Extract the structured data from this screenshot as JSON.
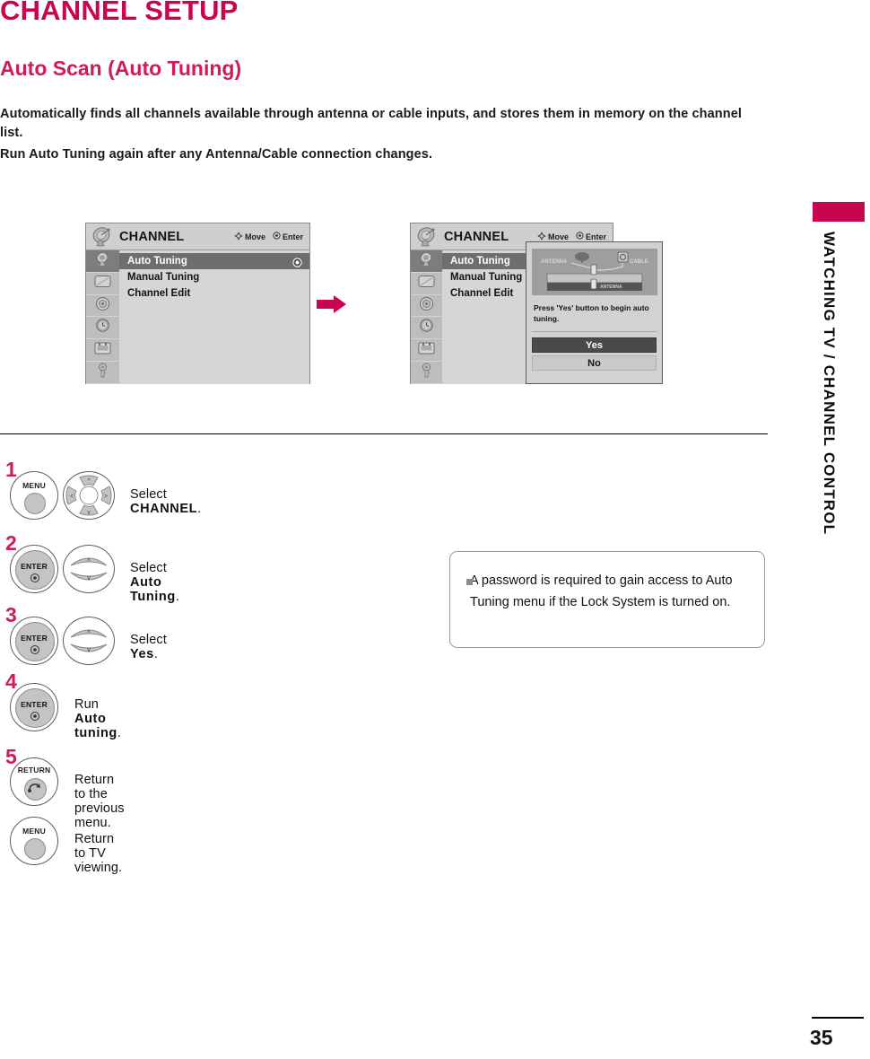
{
  "document": {
    "chapter_title": "CHANNEL SETUP",
    "section_title": "Auto Scan (Auto Tuning)",
    "paragraphs": [
      "Automatically finds all channels available through antenna or cable inputs, and stores them in memory on the channel list.",
      "Run Auto Tuning again after any Antenna/Cable connection changes."
    ],
    "side_tab_label": "WATCHING TV / CHANNEL CONTROL",
    "page_number": "35",
    "accent_color": "#c8064f"
  },
  "osd_before": {
    "menu_title": "CHANNEL",
    "header_icon": "satellite-dish-icon",
    "hints": [
      {
        "icon": "dpad-icon",
        "label": "Move"
      },
      {
        "icon": "enter-dot-icon",
        "label": "Enter"
      }
    ],
    "rail_icons": [
      "channel-dish-icon",
      "picture-tv-icon",
      "audio-speaker-icon",
      "time-clock-icon",
      "option-card-icon",
      "lock-key-icon"
    ],
    "items": [
      {
        "label": "Auto Tuning",
        "selected": true,
        "marker": "radio-dot-icon"
      },
      {
        "label": "Manual Tuning",
        "selected": false
      },
      {
        "label": "Channel Edit",
        "selected": false
      }
    ]
  },
  "osd_after": {
    "menu_title": "CHANNEL",
    "header_icon": "satellite-dish-icon",
    "hints": [
      {
        "icon": "dpad-icon",
        "label": "Move"
      },
      {
        "icon": "enter-dot-icon",
        "label": "Enter"
      }
    ],
    "rail_icons": [
      "channel-dish-icon",
      "picture-tv-icon",
      "audio-speaker-icon",
      "time-clock-icon",
      "option-card-icon",
      "lock-key-icon"
    ],
    "items": [
      {
        "label": "Auto Tuning",
        "selected": true
      },
      {
        "label": "Manual Tuning",
        "selected": false
      },
      {
        "label": "Channel Edit",
        "selected": false
      }
    ],
    "dialog": {
      "illustration": "antenna-cable-connection-diagram",
      "illustration_labels": [
        "ANTENNA",
        "CABLE",
        "ANTENNA"
      ],
      "message": "Press 'Yes' button to begin auto tuning.",
      "buttons": [
        {
          "label": "Yes",
          "highlighted": true
        },
        {
          "label": "No",
          "highlighted": false
        }
      ]
    }
  },
  "flow": {
    "arrow_icon": "right-arrow-icon"
  },
  "steps": [
    {
      "number": "1",
      "buttons": [
        {
          "kind": "round",
          "label": "MENU"
        },
        {
          "kind": "dpad",
          "label": ""
        }
      ],
      "text_prefix": "Select ",
      "text_bold": "CHANNEL",
      "text_suffix": "."
    },
    {
      "number": "2",
      "buttons": [
        {
          "kind": "round-enter",
          "label": "ENTER"
        },
        {
          "kind": "updown",
          "label": ""
        }
      ],
      "text_prefix": "Select ",
      "text_bold": "Auto Tuning",
      "text_suffix": "."
    },
    {
      "number": "3",
      "buttons": [
        {
          "kind": "round-enter",
          "label": "ENTER"
        },
        {
          "kind": "updown",
          "label": ""
        }
      ],
      "text_prefix": "Select ",
      "text_bold": "Yes",
      "text_suffix": "."
    },
    {
      "number": "4",
      "buttons": [
        {
          "kind": "round-enter",
          "label": "ENTER"
        }
      ],
      "text_prefix": "Run ",
      "text_bold": "Auto tuning",
      "text_suffix": "."
    },
    {
      "number": "5",
      "buttons": [
        {
          "kind": "round-return",
          "label": "RETURN"
        }
      ],
      "text_prefix": "Return to the previous menu.",
      "text_bold": "",
      "text_suffix": ""
    },
    {
      "number": "",
      "buttons": [
        {
          "kind": "round",
          "label": "MENU"
        }
      ],
      "text_prefix": "Return to TV viewing.",
      "text_bold": "",
      "text_suffix": ""
    }
  ],
  "note": {
    "bullet": "square-bullet-icon",
    "text": "A password is required to gain access to Auto Tuning menu if the Lock System is turned on."
  }
}
